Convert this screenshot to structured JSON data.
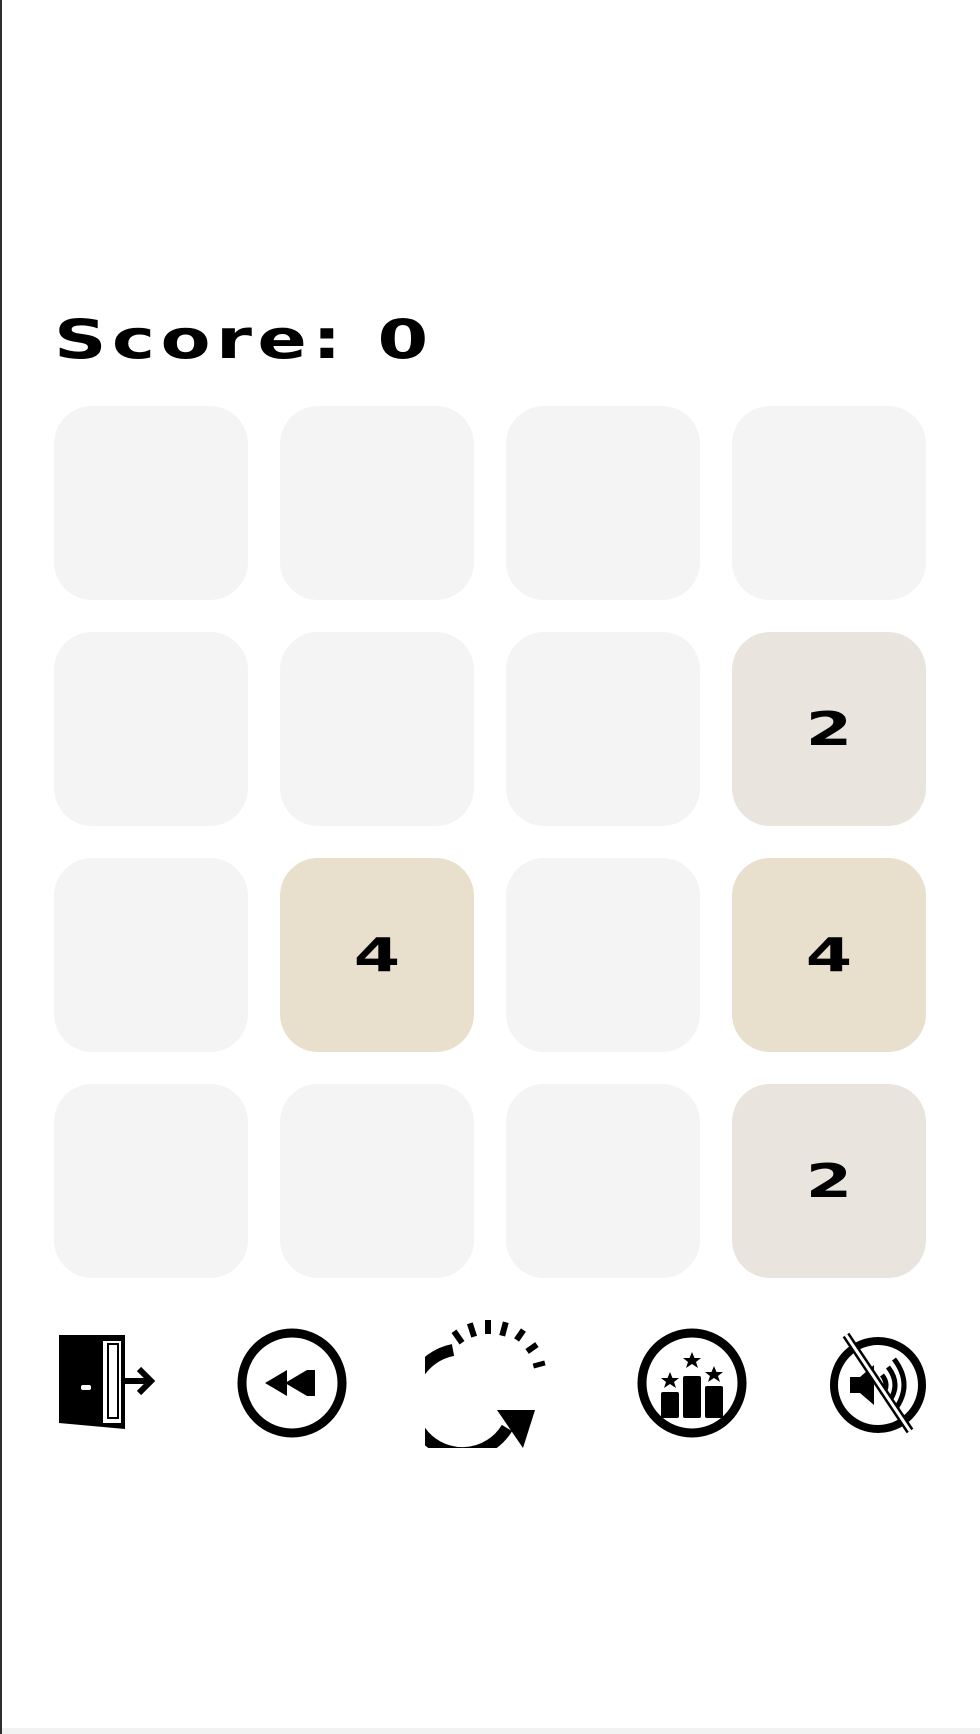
{
  "score": {
    "text": "Score: 0",
    "value": 0
  },
  "board": {
    "rows": 4,
    "cols": 4,
    "cells": [
      [
        "",
        "",
        "",
        ""
      ],
      [
        "",
        "",
        "",
        "2"
      ],
      [
        "",
        "4",
        "",
        "4"
      ],
      [
        "",
        "",
        "",
        "2"
      ]
    ]
  },
  "colors": {
    "empty_tile": "#f4f4f4",
    "tile_2": "#eae4de",
    "tile_4": "#e8e0cd",
    "text": "#000000",
    "background": "#ffffff"
  },
  "controls": [
    {
      "name": "exit-button",
      "icon": "exit-door-icon"
    },
    {
      "name": "undo-button",
      "icon": "rewind-icon"
    },
    {
      "name": "restart-button",
      "icon": "restart-arrow-icon"
    },
    {
      "name": "leaderboard-button",
      "icon": "podium-stars-icon"
    },
    {
      "name": "sound-toggle-button",
      "icon": "sound-muted-icon"
    }
  ]
}
